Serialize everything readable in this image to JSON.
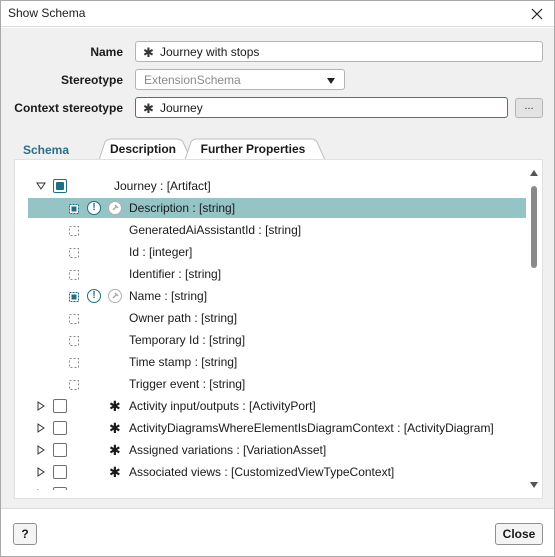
{
  "window": {
    "title": "Show Schema",
    "close_icon": "close-icon"
  },
  "form": {
    "name_label": "Name",
    "name_value": "Journey with stops",
    "stereotype_label": "Stereotype",
    "stereotype_value": "ExtensionSchema",
    "context_label": "Context stereotype",
    "context_value": "Journey",
    "browse_label": "..."
  },
  "tabs": [
    {
      "label": "Schema",
      "active": true
    },
    {
      "label": "Description",
      "active": false
    },
    {
      "label": "Further Properties",
      "active": false
    }
  ],
  "tree": {
    "root": {
      "label": "Journey : [Artifact]",
      "expanded": true,
      "checked": true
    },
    "attributes": [
      {
        "label": "Description : [string]",
        "selected": true,
        "required": true,
        "marked": true
      },
      {
        "label": "GeneratedAiAssistantId : [string]",
        "selected": false,
        "required": false,
        "marked": false
      },
      {
        "label": "Id : [integer]",
        "selected": false,
        "required": false,
        "marked": false
      },
      {
        "label": "Identifier : [string]",
        "selected": false,
        "required": false,
        "marked": false
      },
      {
        "label": "Name : [string]",
        "selected": false,
        "required": true,
        "marked": true
      },
      {
        "label": "Owner path : [string]",
        "selected": false,
        "required": false,
        "marked": false
      },
      {
        "label": "Temporary Id : [string]",
        "selected": false,
        "required": false,
        "marked": false
      },
      {
        "label": "Time stamp : [string]",
        "selected": false,
        "required": false,
        "marked": false
      },
      {
        "label": "Trigger event : [string]",
        "selected": false,
        "required": false,
        "marked": false
      }
    ],
    "references": [
      {
        "label": "Activity input/outputs : [ActivityPort]"
      },
      {
        "label": "ActivityDiagramsWhereElementIsDiagramContext : [ActivityDiagram]"
      },
      {
        "label": "Assigned variations : [VariationAsset]"
      },
      {
        "label": "Associated views : [CustomizedViewTypeContext]"
      }
    ]
  },
  "footer": {
    "help_label": "?",
    "close_label": "Close"
  },
  "colors": {
    "accent": "#1f6f84",
    "selection": "#95c4c6",
    "panel": "#f0f0f0"
  }
}
